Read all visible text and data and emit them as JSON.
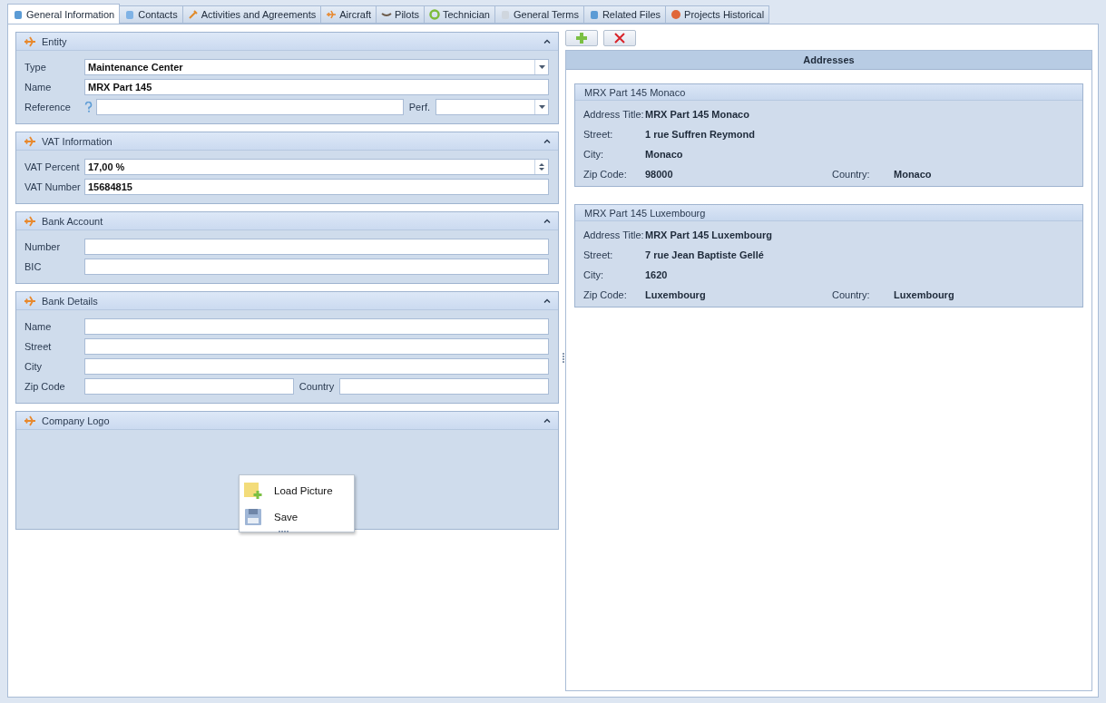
{
  "tabs": [
    {
      "label": "General Information",
      "selected": true
    },
    {
      "label": "Contacts",
      "selected": false
    },
    {
      "label": "Activities and Agreements",
      "selected": false
    },
    {
      "label": "Aircraft",
      "selected": false
    },
    {
      "label": "Pilots",
      "selected": false
    },
    {
      "label": "Technician",
      "selected": false
    },
    {
      "label": "General Terms",
      "selected": false
    },
    {
      "label": "Related Files",
      "selected": false
    },
    {
      "label": "Projects Historical",
      "selected": false
    }
  ],
  "sections": [
    {
      "kind": "form",
      "title": "Entity",
      "expanded": true,
      "rows": [
        [
          {
            "kind": "label",
            "text": "Type"
          },
          {
            "kind": "combo",
            "value": "Maintenance Center"
          }
        ],
        [
          {
            "kind": "label",
            "text": "Name"
          },
          {
            "kind": "text",
            "value": "MRX Part 145"
          }
        ],
        [
          {
            "kind": "label",
            "text": "Reference"
          },
          {
            "kind": "help"
          },
          {
            "kind": "text"
          },
          {
            "kind": "label",
            "text": "Perf."
          },
          {
            "kind": "combo"
          }
        ]
      ]
    },
    {
      "kind": "form",
      "title": "VAT Information",
      "expanded": true,
      "rows": [
        [
          {
            "kind": "label",
            "text": "VAT Percent"
          },
          {
            "kind": "spin",
            "value": "17,00 %"
          }
        ],
        [
          {
            "kind": "label",
            "text": "VAT Number"
          },
          {
            "kind": "text",
            "value": "15684815"
          }
        ]
      ]
    },
    {
      "kind": "form",
      "title": "Bank Account",
      "expanded": true,
      "rows": [
        [
          {
            "kind": "label",
            "text": "Number"
          },
          {
            "kind": "text"
          }
        ],
        [
          {
            "kind": "label",
            "text": "BIC"
          },
          {
            "kind": "text"
          }
        ]
      ]
    },
    {
      "kind": "form",
      "title": "Bank Details",
      "expanded": true,
      "rows": [
        [
          {
            "kind": "label",
            "text": "Name"
          },
          {
            "kind": "text"
          }
        ],
        [
          {
            "kind": "label",
            "text": "Street"
          },
          {
            "kind": "text"
          }
        ],
        [
          {
            "kind": "label",
            "text": "City"
          },
          {
            "kind": "text"
          }
        ],
        [
          {
            "kind": "label",
            "text": "Zip Code"
          },
          {
            "kind": "text"
          },
          {
            "kind": "label",
            "text": "Country"
          },
          {
            "kind": "text"
          }
        ]
      ]
    },
    {
      "kind": "logo",
      "title": "Company Logo",
      "expanded": true,
      "menu": [
        {
          "label": "Load Picture"
        },
        {
          "label": "Save"
        }
      ]
    }
  ],
  "addresses": {
    "title": "Addresses",
    "cards": [
      {
        "title": "MRX Part 145 Monaco",
        "rows": [
          [
            {
              "label": "Address Title:",
              "value": "MRX Part 145 Monaco"
            }
          ],
          [
            {
              "label": "Street:",
              "value": "1 rue Suffren Reymond"
            }
          ],
          [
            {
              "label": "City:",
              "value": "Monaco"
            }
          ],
          [
            {
              "label": "Zip Code:",
              "value": "98000"
            },
            {
              "label": "Country:",
              "value": "Monaco"
            }
          ]
        ]
      },
      {
        "title": "MRX Part 145 Luxembourg",
        "rows": [
          [
            {
              "label": "Address Title:",
              "value": "MRX Part 145 Luxembourg"
            }
          ],
          [
            {
              "label": "Street:",
              "value": "7 rue Jean Baptiste Gellé"
            }
          ],
          [
            {
              "label": "City:",
              "value": "1620"
            }
          ],
          [
            {
              "label": "Zip Code:",
              "value": "Luxembourg"
            },
            {
              "label": "Country:",
              "value": "Luxembourg"
            }
          ]
        ]
      }
    ]
  }
}
